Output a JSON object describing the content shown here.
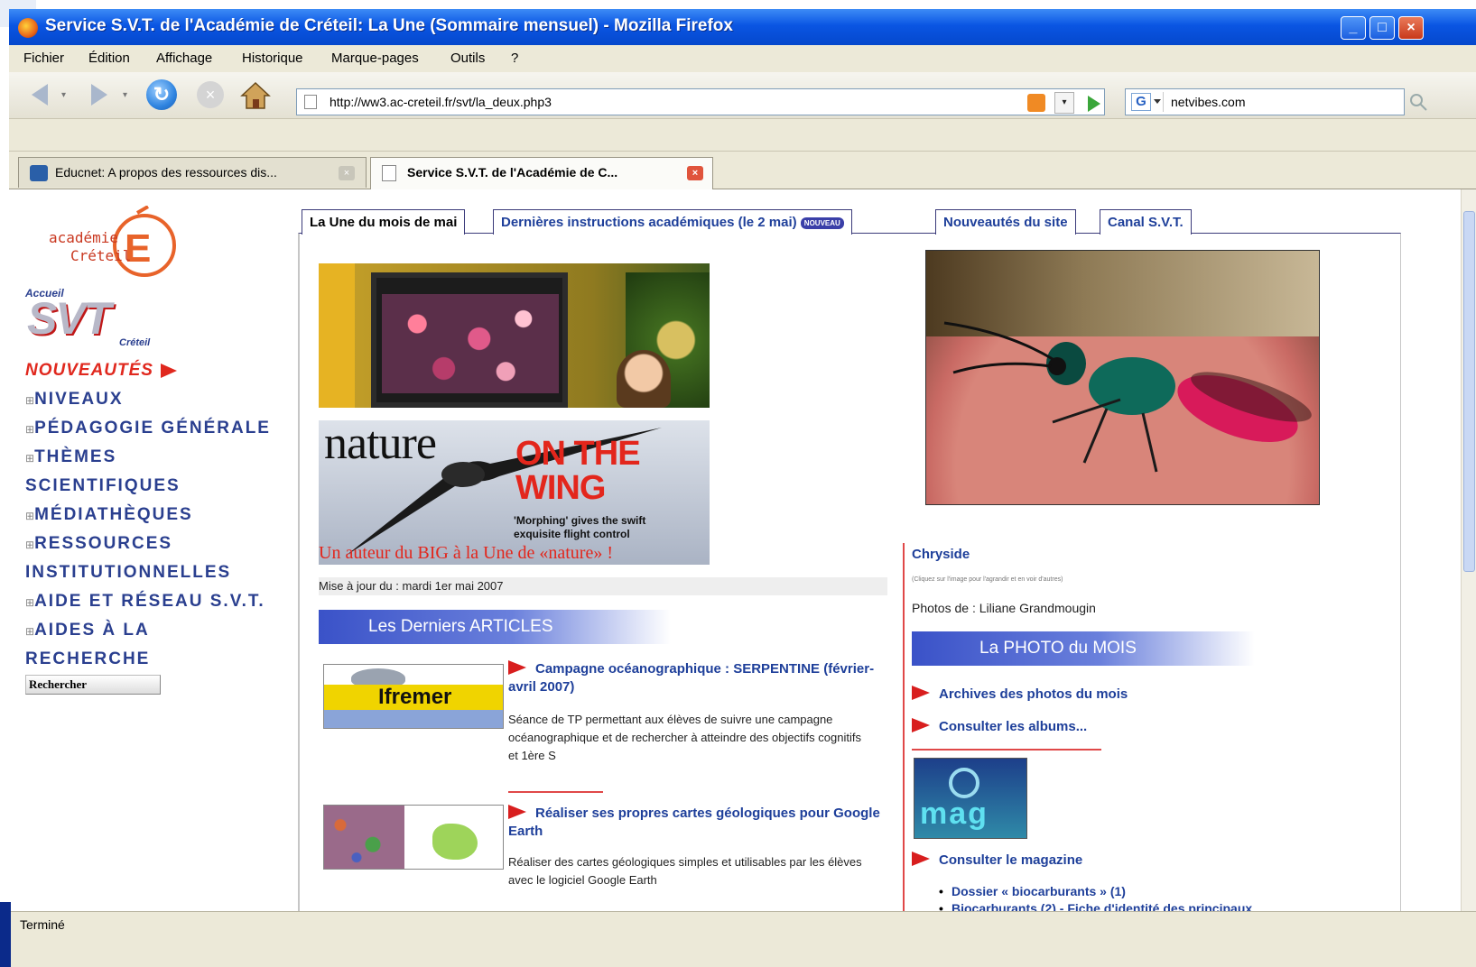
{
  "window": {
    "title": "Service S.V.T. de l'Académie de Créteil: La Une (Sommaire mensuel) - Mozilla Firefox"
  },
  "menu": [
    "Fichier",
    "Édition",
    "Affichage",
    "Historique",
    "Marque-pages",
    "Outils",
    "?"
  ],
  "toolbar": {
    "url": "http://ww3.ac-creteil.fr/svt/la_deux.php3",
    "search_value": "netvibes.com"
  },
  "tabs": [
    {
      "label": "Educnet: A propos des ressources dis..."
    },
    {
      "label": "Service S.V.T. de l'Académie de C..."
    }
  ],
  "status": "Terminé",
  "sidebar": {
    "logo_academie": [
      "académie",
      "Créteil"
    ],
    "logo_svt": {
      "top": "Accueil",
      "main": "SVT",
      "bottom": "Créteil"
    },
    "items": [
      {
        "label": "NOUVEAUTÉS"
      },
      {
        "label": "NIVEAUX"
      },
      {
        "label": "PÉDAGOGIE GÉNÉRALE"
      },
      {
        "label": "THÈMES"
      },
      {
        "label": "SCIENTIFIQUES"
      },
      {
        "label": "MÉDIATHÈQUES"
      },
      {
        "label": "RESSOURCES"
      },
      {
        "label": "INSTITUTIONNELLES"
      },
      {
        "label": "AIDE ET RÉSEAU S.V.T."
      },
      {
        "label": "AIDES À LA"
      },
      {
        "label": "RECHERCHE"
      }
    ],
    "search_button": "Rechercher"
  },
  "page_tabs": [
    {
      "label": "La Une du mois de mai"
    },
    {
      "label": "Dernières instructions académiques (le 2 mai)",
      "badge": "NOUVEAU"
    },
    {
      "label": "Nouveautés du site"
    },
    {
      "label": "Canal S.V.T."
    }
  ],
  "feature": {
    "nature_word": "nature",
    "nature_headline": [
      "ON THE",
      "WING"
    ],
    "nature_subtext": [
      "'Morphing' gives the swift",
      "exquisite flight control"
    ],
    "nature_caption": "Un auteur du BIG à la Une de «nature» !",
    "update": "Mise à jour du : mardi 1er mai 2007"
  },
  "articles": {
    "banner": "Les Derniers ARTICLES",
    "items": [
      {
        "thumb_text": "Ifremer",
        "title": "Campagne océanographique : SERPENTINE (février-avril 2007)",
        "desc": "Séance de TP permettant aux élèves de suivre une campagne océanographique et de rechercher à atteindre des objectifs cognitifs et 1ère S"
      },
      {
        "thumb_text": "",
        "title": "Réaliser ses propres cartes géologiques pour Google Earth",
        "desc": "Réaliser des cartes géologiques simples et utilisables par les élèves avec le logiciel Google Earth"
      }
    ]
  },
  "photo": {
    "title": "Chryside",
    "tiny": "(Cliquez sur l'image pour l'agrandir et en voir d'autres)",
    "credit": "Photos de : Liliane Grandmougin",
    "banner": "La PHOTO du MOIS",
    "links": [
      "Archives des photos du mois",
      "Consulter les albums..."
    ],
    "mag_text": "mag",
    "mag_link": "Consulter le magazine",
    "bullets": [
      "Dossier « biocarburants » (1)",
      "Biocarburants (2) - Fiche d'identité des principaux"
    ]
  },
  "colors": {
    "titlebar": "#0a55e3",
    "link_blue": "#1e3f9a",
    "accent_red": "#e0281e",
    "banner_blue": "#3a52c8"
  }
}
